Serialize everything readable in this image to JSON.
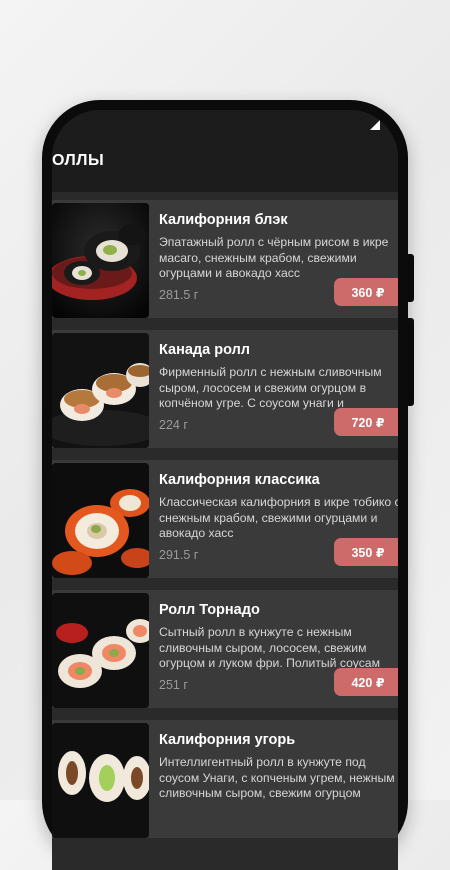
{
  "header": {
    "title": "ОЛЛЫ"
  },
  "items": [
    {
      "name": "Калифорния блэк",
      "description": "Эпатажный ролл с чёрным рисом в икре масаго, снежным крабом, свежими огурцами и авокадо хасс",
      "weight": "281.5 г",
      "price": "360 ₽"
    },
    {
      "name": "Канада ролл",
      "description": "Фирменный ролл с нежным сливочным сыром, лососем и свежим огурцом в копчёном угре. С соусом унаги и",
      "weight": "224 г",
      "price": "720 ₽"
    },
    {
      "name": "Калифорния классика",
      "description": "Классическая калифорния в икре тобико с снежным крабом, свежими огурцами и авокадо хасс",
      "weight": "291.5 г",
      "price": "350 ₽"
    },
    {
      "name": "Ролл Торнадо",
      "description": "Сытный ролл в кунжуте с нежным сливочным сыром, лососем, свежим огурцом и луком фри. Политый соусам",
      "weight": "251 г",
      "price": "420 ₽"
    },
    {
      "name": "Калифорния угорь",
      "description": "Интеллигентный ролл в кунжуте под соусом Унаги, с копченым угрем, нежным сливочным сыром, свежим огурцом",
      "weight": "",
      "price": ""
    }
  ],
  "colors": {
    "accent": "#cd6a6a",
    "card": "#3a3a3a",
    "header": "#1c1c1c"
  }
}
